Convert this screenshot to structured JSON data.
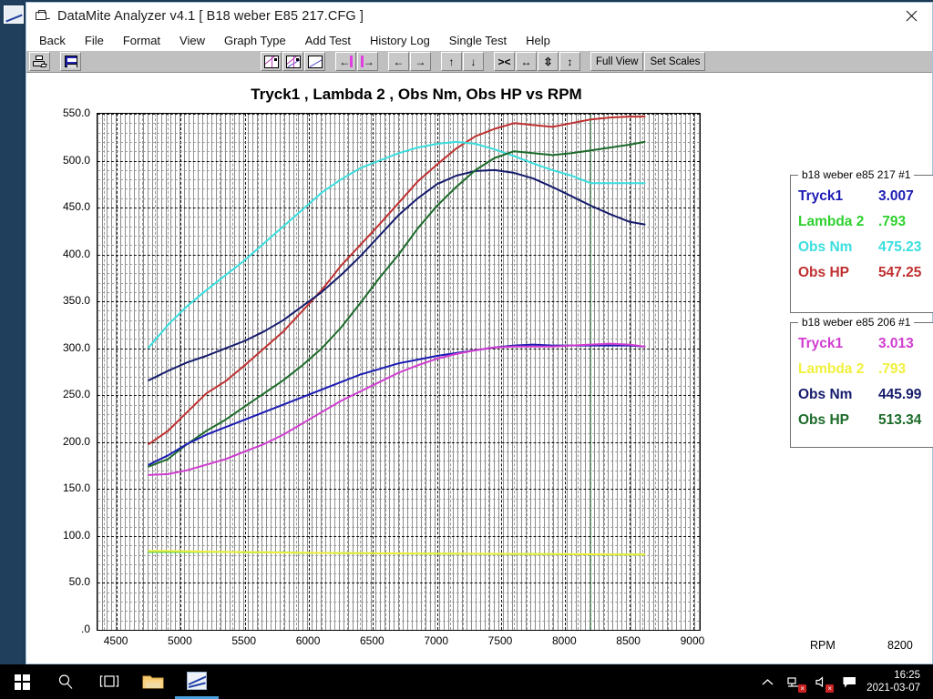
{
  "window": {
    "title": "DataMite Analyzer v4.1  [ B18 weber E85 217.CFG ]",
    "close_label": "✕",
    "icon": "folder-icon"
  },
  "menu": {
    "items": [
      {
        "label": "Back"
      },
      {
        "label": "File"
      },
      {
        "label": "Format"
      },
      {
        "label": "View"
      },
      {
        "label": "Graph Type"
      },
      {
        "label": "Add Test"
      },
      {
        "label": "History Log"
      },
      {
        "label": "Single Test"
      },
      {
        "label": "Help"
      }
    ]
  },
  "toolbar": {
    "buttons": [
      {
        "name": "print-button",
        "icon": "printer-icon",
        "label": ""
      },
      {
        "name": "save-button",
        "icon": "floppy-disk-icon",
        "label": ""
      },
      {
        "name": "graph-type-1-button",
        "icon": "graph-magenta-icon",
        "label": ""
      },
      {
        "name": "graph-type-2-button",
        "icon": "graph-blue-icon",
        "label": ""
      },
      {
        "name": "graph-type-3-button",
        "icon": "graph-plain-icon",
        "label": ""
      },
      {
        "name": "step-left-button",
        "icon": "arrow-left-bar-icon",
        "label": ""
      },
      {
        "name": "step-right-button",
        "icon": "arrow-right-bar-icon",
        "label": ""
      },
      {
        "name": "pan-left-button",
        "icon": "arrow-left-icon",
        "label": ""
      },
      {
        "name": "pan-right-button",
        "icon": "arrow-right-icon",
        "label": ""
      },
      {
        "name": "pan-up-button",
        "icon": "arrow-up-icon",
        "label": ""
      },
      {
        "name": "pan-down-button",
        "icon": "arrow-down-icon",
        "label": ""
      },
      {
        "name": "zoom-in-horizontal-button",
        "icon": "arrows-inward-icon",
        "label": ""
      },
      {
        "name": "zoom-out-horizontal-button",
        "icon": "arrows-horizontal-icon",
        "label": ""
      },
      {
        "name": "zoom-in-vertical-button",
        "icon": "arrows-vertical-inward-icon",
        "label": ""
      },
      {
        "name": "zoom-out-vertical-button",
        "icon": "arrows-vertical-icon",
        "label": ""
      }
    ],
    "full_view_label": "Full View",
    "set_scales_label": "Set Scales"
  },
  "chart_data": {
    "type": "line",
    "title": "Tryck1 , Lambda 2 , Obs Nm, Obs HP vs RPM",
    "xlabel": "RPM",
    "ylabel": "",
    "xlim": [
      4350,
      9050
    ],
    "ylim": [
      0,
      550
    ],
    "grid": true,
    "x_ticks": [
      4500,
      5000,
      5500,
      6000,
      6500,
      7000,
      7500,
      8000,
      8500,
      9000
    ],
    "y_ticks": [
      "550.0",
      "500.0",
      "450.0",
      "400.0",
      "350.0",
      "300.0",
      "250.0",
      "200.0",
      "150.0",
      "100.0",
      "50.0",
      ".0"
    ],
    "y_tick_values": [
      550,
      500,
      450,
      400,
      350,
      300,
      250,
      200,
      150,
      100,
      50,
      0
    ],
    "cursor_rpm": 8200,
    "x": [
      4750,
      4900,
      5050,
      5200,
      5350,
      5500,
      5650,
      5800,
      5950,
      6100,
      6250,
      6400,
      6550,
      6700,
      6850,
      7000,
      7150,
      7300,
      7450,
      7600,
      7750,
      7900,
      8050,
      8200,
      8350,
      8500,
      8620
    ],
    "series": [
      {
        "name": "Obs HP 217",
        "color": "#c03030",
        "values": [
          198,
          212,
          232,
          252,
          265,
          282,
          300,
          318,
          340,
          362,
          388,
          410,
          432,
          455,
          478,
          496,
          513,
          526,
          534,
          540,
          538,
          536,
          540,
          544,
          546,
          547,
          547
        ]
      },
      {
        "name": "Obs Nm 217",
        "color": "#3adede",
        "values": [
          301,
          325,
          345,
          362,
          378,
          394,
          412,
          430,
          448,
          466,
          480,
          492,
          500,
          508,
          514,
          518,
          520,
          518,
          512,
          505,
          497,
          490,
          484,
          476,
          476,
          476,
          476
        ]
      },
      {
        "name": "Obs Nm 206",
        "color": "#151b6b",
        "values": [
          266,
          276,
          285,
          292,
          300,
          308,
          318,
          330,
          345,
          360,
          378,
          398,
          420,
          442,
          460,
          475,
          484,
          489,
          490,
          487,
          481,
          472,
          462,
          452,
          443,
          435,
          432
        ]
      },
      {
        "name": "Obs HP 206",
        "color": "#1c6b2a",
        "values": [
          174,
          182,
          198,
          212,
          224,
          238,
          252,
          266,
          282,
          300,
          322,
          348,
          375,
          400,
          428,
          452,
          472,
          490,
          503,
          510,
          508,
          506,
          508,
          511,
          514,
          517,
          520
        ]
      },
      {
        "name": "Tryck1 217",
        "color": "#1b1bb5",
        "values": [
          176,
          186,
          198,
          208,
          216,
          224,
          232,
          240,
          248,
          256,
          264,
          272,
          278,
          284,
          288,
          292,
          295,
          298,
          301,
          303,
          304,
          303,
          303,
          303,
          303,
          303,
          302
        ]
      },
      {
        "name": "Tryck1 206",
        "color": "#d03cd0",
        "values": [
          165,
          166,
          170,
          176,
          182,
          190,
          198,
          208,
          220,
          232,
          244,
          254,
          264,
          274,
          282,
          289,
          294,
          298,
          301,
          302,
          302,
          302,
          303,
          304,
          305,
          304,
          302
        ]
      },
      {
        "name": "Lambda 2 217",
        "color": "#2ed12e",
        "values": [
          83,
          83,
          83,
          83,
          83,
          82.5,
          82.5,
          82.5,
          82,
          82,
          81.8,
          81.6,
          81.5,
          81.4,
          81.3,
          81.2,
          81.1,
          81,
          80.9,
          80.8,
          80.7,
          80.6,
          80.5,
          80.4,
          80.3,
          80.2,
          80.1
        ]
      },
      {
        "name": "Lambda 2 206",
        "color": "#f0f03c",
        "values": [
          84,
          84,
          83.6,
          83.3,
          83,
          82.8,
          82.6,
          82.4,
          82.2,
          82,
          81.9,
          81.8,
          81.6,
          81.5,
          81.4,
          81.3,
          81.2,
          81.1,
          81,
          80.9,
          80.8,
          80.7,
          80.6,
          80.5,
          80.4,
          80.3,
          80.2
        ]
      }
    ]
  },
  "rpm_readout": {
    "label": "RPM",
    "value": "8200"
  },
  "legends": [
    {
      "title": "b18 weber e85 217   #1",
      "rows": [
        {
          "name": "Tryck1",
          "value": "3.007",
          "color": "#1b1bb5"
        },
        {
          "name": "Lambda 2",
          "value": ".793",
          "color": "#2ed12e"
        },
        {
          "name": "Obs Nm",
          "value": "475.23",
          "color": "#3adede"
        },
        {
          "name": "Obs HP",
          "value": "547.25",
          "color": "#c03030"
        }
      ]
    },
    {
      "title": "b18 weber e85 206   #1",
      "rows": [
        {
          "name": "Tryck1",
          "value": "3.013",
          "color": "#d03cd0"
        },
        {
          "name": "Lambda 2",
          "value": ".793",
          "color": "#f0f03c"
        },
        {
          "name": "Obs Nm",
          "value": "445.99",
          "color": "#151b6b"
        },
        {
          "name": "Obs HP",
          "value": "513.34",
          "color": "#1c6b2a"
        }
      ]
    }
  ],
  "taskbar": {
    "items": [
      {
        "name": "start-button",
        "icon": "windows-logo-icon"
      },
      {
        "name": "search-button",
        "icon": "search-icon"
      },
      {
        "name": "task-view-button",
        "icon": "task-view-icon"
      },
      {
        "name": "file-explorer-button",
        "icon": "folder-icon"
      },
      {
        "name": "datamite-analyzer-button",
        "icon": "analyzer-app-icon"
      }
    ],
    "tray": [
      {
        "name": "show-hidden-icons",
        "icon": "chevron-up-icon"
      },
      {
        "name": "network-status-icon",
        "icon": "network-disconnected-icon"
      },
      {
        "name": "volume-icon",
        "icon": "speaker-muted-icon"
      },
      {
        "name": "action-center-icon",
        "icon": "speech-bubble-icon"
      }
    ],
    "clock_time": "16:25",
    "clock_date": "2021-03-07"
  },
  "desktop": {
    "icon_label": ""
  }
}
